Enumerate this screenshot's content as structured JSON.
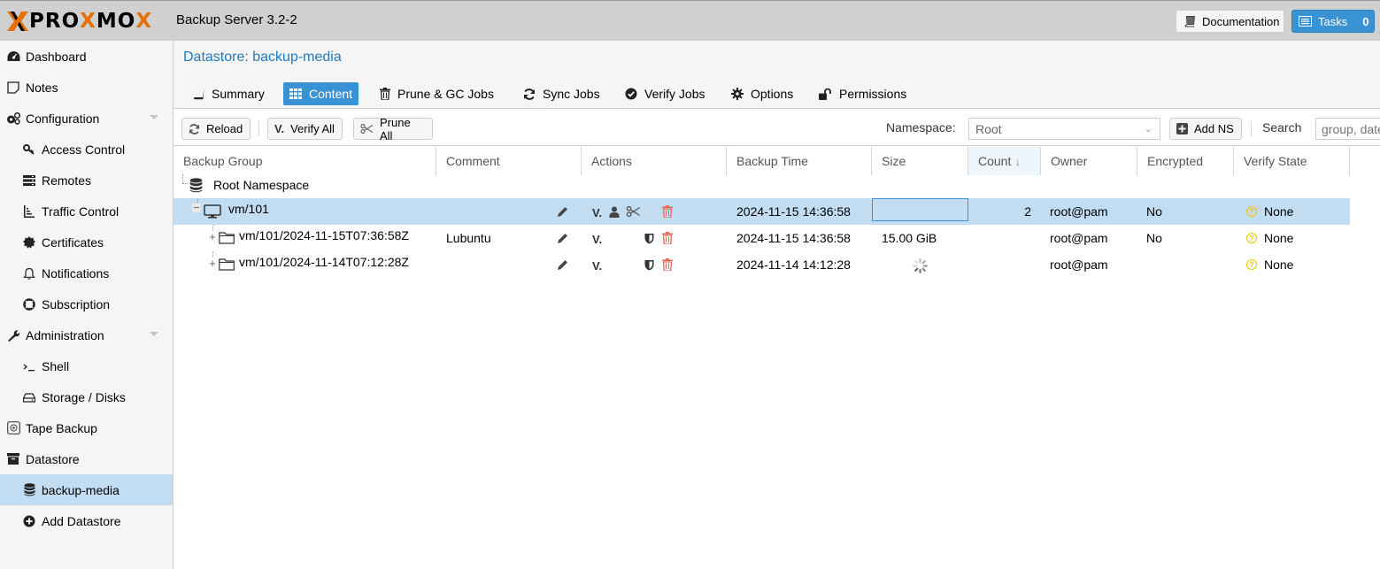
{
  "header": {
    "logo_left": "X",
    "logo_text1": "PRO",
    "logo_mid": "X",
    "logo_text2": "MO",
    "logo_end": "X",
    "product": "Backup Server 3.2-2",
    "documentation_label": "Documentation",
    "tasks_label": "Tasks",
    "tasks_count": "0"
  },
  "sidebar": {
    "items": [
      {
        "label": "Dashboard",
        "icon": "dashboard-icon"
      },
      {
        "label": "Notes",
        "icon": "notes-icon"
      },
      {
        "label": "Configuration",
        "icon": "cogs-icon"
      },
      {
        "label": "Access Control",
        "icon": "key-icon"
      },
      {
        "label": "Remotes",
        "icon": "server-icon"
      },
      {
        "label": "Traffic Control",
        "icon": "traffic-icon"
      },
      {
        "label": "Certificates",
        "icon": "certificate-icon"
      },
      {
        "label": "Notifications",
        "icon": "bell-icon"
      },
      {
        "label": "Subscription",
        "icon": "lifebuoy-icon"
      },
      {
        "label": "Administration",
        "icon": "wrench-icon"
      },
      {
        "label": "Shell",
        "icon": "terminal-icon"
      },
      {
        "label": "Storage / Disks",
        "icon": "hdd-icon"
      },
      {
        "label": "Tape Backup",
        "icon": "tape-icon"
      },
      {
        "label": "Datastore",
        "icon": "archive-icon"
      },
      {
        "label": "backup-media",
        "icon": "database-icon"
      },
      {
        "label": "Add Datastore",
        "icon": "plus-circle-icon"
      }
    ]
  },
  "panel": {
    "title": "Datastore: backup-media",
    "tabs": [
      {
        "label": "Summary"
      },
      {
        "label": "Content"
      },
      {
        "label": "Prune & GC Jobs"
      },
      {
        "label": "Sync Jobs"
      },
      {
        "label": "Verify Jobs"
      },
      {
        "label": "Options"
      },
      {
        "label": "Permissions"
      }
    ],
    "active_tab": "Content"
  },
  "toolbar": {
    "reload_label": "Reload",
    "verify_all_label": "Verify All",
    "prune_all_label": "Prune All",
    "namespace_label": "Namespace:",
    "namespace_value": "Root",
    "add_ns_label": "Add NS",
    "search_label": "Search",
    "search_placeholder": "group, date or owner"
  },
  "grid": {
    "columns": [
      "Backup Group",
      "Comment",
      "Actions",
      "Backup Time",
      "Size",
      "Count",
      "Owner",
      "Encrypted",
      "Verify State"
    ],
    "sorted_column": "Count",
    "verify_glyph": "V.",
    "rows": [
      {
        "level": 0,
        "name": "Root Namespace",
        "type": "namespace",
        "comment": "",
        "backup_time": "",
        "size": "",
        "count": "",
        "owner": "",
        "encrypted": "",
        "verify_state": ""
      },
      {
        "level": 1,
        "name": "vm/101",
        "type": "group",
        "comment": "",
        "backup_time": "2024-11-15 14:36:58",
        "size": "",
        "count": "2",
        "owner": "root@pam",
        "encrypted": "No",
        "verify_state": "None",
        "selected": true
      },
      {
        "level": 2,
        "name": "vm/101/2024-11-15T07:36:58Z",
        "type": "snapshot",
        "comment": "Lubuntu",
        "backup_time": "2024-11-15 14:36:58",
        "size": "15.00 GiB",
        "count": "",
        "owner": "root@pam",
        "encrypted": "No",
        "verify_state": "None"
      },
      {
        "level": 2,
        "name": "vm/101/2024-11-14T07:12:28Z",
        "type": "snapshot",
        "comment": "",
        "backup_time": "2024-11-14 14:12:28",
        "size": "loading",
        "count": "",
        "owner": "root@pam",
        "encrypted": "",
        "verify_state": "None"
      }
    ]
  }
}
